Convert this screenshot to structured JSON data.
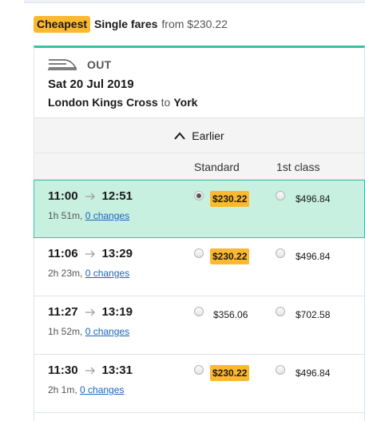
{
  "banner": {
    "badge": "Cheapest",
    "title": "Single fares",
    "from": "from $230.22"
  },
  "journey": {
    "direction": "OUT",
    "date": "Sat 20 Jul 2019",
    "origin": "London Kings Cross",
    "to_word": "to",
    "destination": "York"
  },
  "earlier_label": "Earlier",
  "columns": {
    "standard": "Standard",
    "first": "1st class"
  },
  "rows": [
    {
      "depart": "11:00",
      "arrive": "12:51",
      "duration": "1h 51m,",
      "changes": "0 changes",
      "standard_price": "$230.22",
      "first_price": "$496.84",
      "selected": true,
      "cheapest": true
    },
    {
      "depart": "11:06",
      "arrive": "13:29",
      "duration": "2h 23m,",
      "changes": "0 changes",
      "standard_price": "$230.22",
      "first_price": "$496.84",
      "selected": false,
      "cheapest": true
    },
    {
      "depart": "11:27",
      "arrive": "13:19",
      "duration": "1h 52m,",
      "changes": "0 changes",
      "standard_price": "$356.06",
      "first_price": "$702.58",
      "selected": false,
      "cheapest": false
    },
    {
      "depart": "11:30",
      "arrive": "13:31",
      "duration": "2h 1m,",
      "changes": "0 changes",
      "standard_price": "$230.22",
      "first_price": "$496.84",
      "selected": false,
      "cheapest": true
    }
  ],
  "colors": {
    "accent": "#36c3a2",
    "selected_bg": "#c7f0e1",
    "cheapest_badge": "#fcb82e",
    "link": "#1c63b7"
  },
  "icons": {
    "train": "train-icon",
    "earlier": "chevron-up-icon",
    "arrow": "arrow-right-icon"
  }
}
